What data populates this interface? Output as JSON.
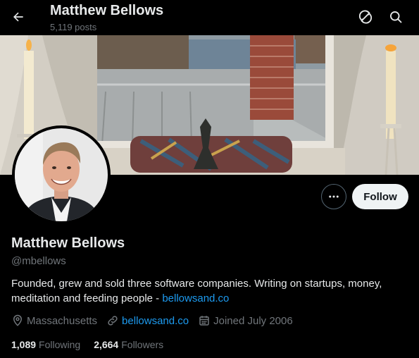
{
  "header": {
    "title": "Matthew Bellows",
    "post_count": "5,119 posts",
    "back_icon": "arrow-left-icon",
    "refresh_icon": "refresh-icon",
    "search_icon": "search-icon"
  },
  "profile": {
    "name": "Matthew Bellows",
    "handle": "@mbellows",
    "bio_text": "Founded, grew and sold three software companies. Writing on startups, money, meditation and feeding people - ",
    "bio_link": "bellowsand.co",
    "location": "Massachusetts",
    "website": "bellowsand.co",
    "joined": "Joined July 2006",
    "follow_label": "Follow",
    "more_icon": "more-icon"
  },
  "stats": {
    "following_count": "1,089",
    "following_label": "Following",
    "followers_count": "2,664",
    "followers_label": "Followers"
  },
  "colors": {
    "background": "#000000",
    "text_primary": "#e7e9ea",
    "text_secondary": "#71767b",
    "link": "#1d9bf0",
    "button_bg": "#eff3f4"
  }
}
